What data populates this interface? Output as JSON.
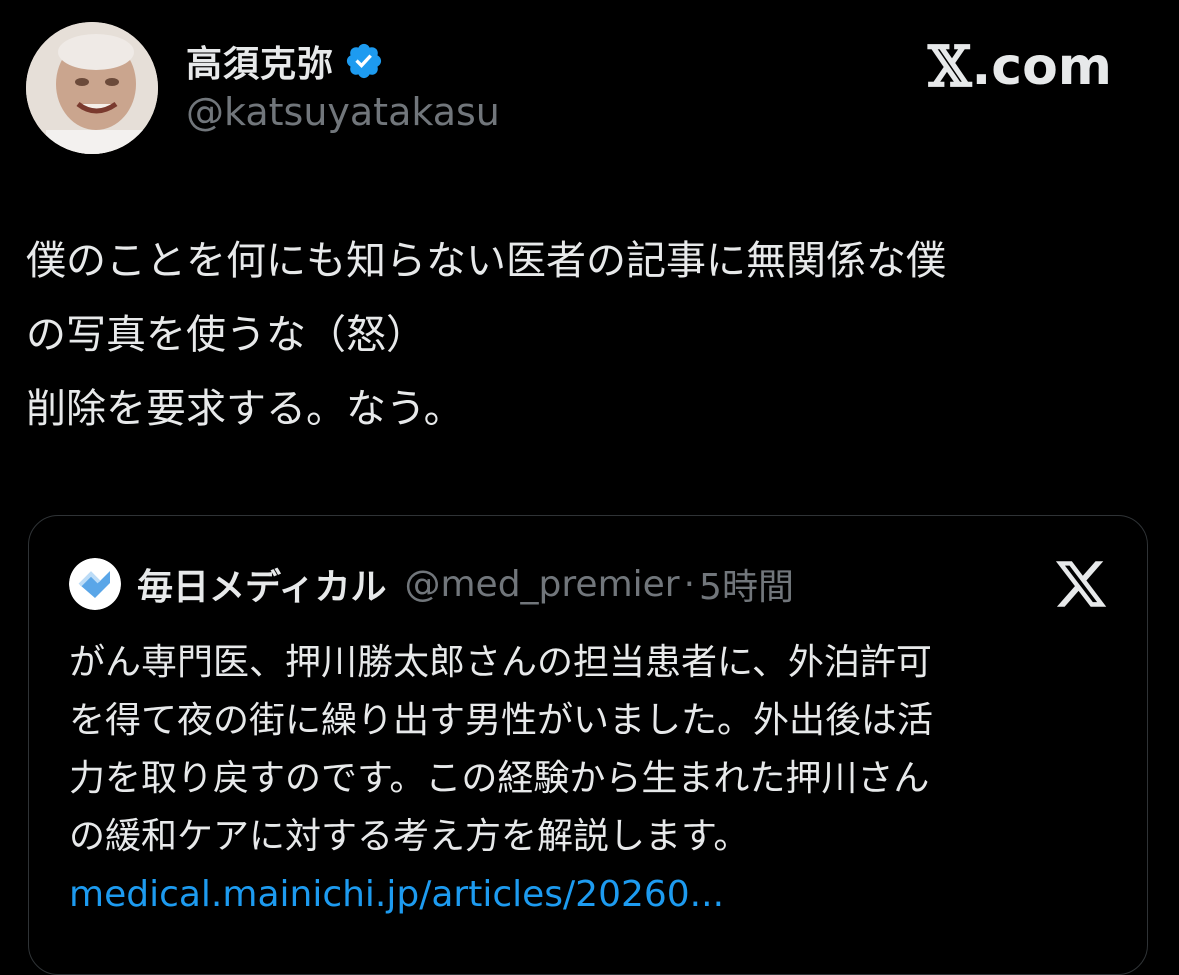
{
  "post": {
    "author_name": "高須克弥",
    "author_handle": "@katsuyatakasu",
    "verified": true,
    "text_lines": [
      "僕のことを何にも知らない医者の記事に無関係な僕",
      "の写真を使うな（怒）",
      "削除を要求する。なう。"
    ]
  },
  "source": {
    "label": ".com",
    "icon": "x-logo-icon"
  },
  "quote": {
    "author_name": "毎日メディカル",
    "author_handle": "@med_premier",
    "separator": "·",
    "time": "5時間",
    "text_lines": [
      "がん専門医、押川勝太郎さんの担当患者に、外泊許可",
      "を得て夜の街に繰り出す男性がいました。外出後は活",
      "力を取り戻すのです。この経験から生まれた押川さん",
      "の緩和ケアに対する考え方を解説します。"
    ],
    "link": "medical.mainichi.jp/articles/20260..."
  },
  "colors": {
    "background": "#000000",
    "text": "#e7e9ea",
    "secondary": "#71767b",
    "link": "#1d9bf0",
    "verified": "#1d9bf0",
    "border": "#2f3336"
  }
}
